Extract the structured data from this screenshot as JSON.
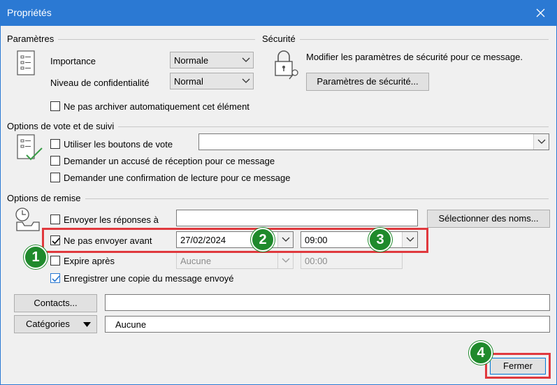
{
  "window": {
    "title": "Propriétés"
  },
  "parametres": {
    "section_label": "Paramètres",
    "importance_label": "Importance",
    "importance_value": "Normale",
    "confidentialite_label": "Niveau de confidentialité",
    "confidentialite_value": "Normal",
    "no_archive_label": "Ne pas archiver automatiquement cet élément"
  },
  "securite": {
    "section_label": "Sécurité",
    "description": "Modifier les paramètres de sécurité pour ce message.",
    "button_label": "Paramètres de sécurité..."
  },
  "vote": {
    "section_label": "Options de vote et de suivi",
    "use_vote_buttons_label": "Utiliser les boutons de vote",
    "vote_value": "",
    "delivery_receipt_label": "Demander un accusé de réception pour ce message",
    "read_receipt_label": "Demander une confirmation de lecture pour ce message"
  },
  "remise": {
    "section_label": "Options de remise",
    "reply_to_label": "Envoyer les réponses à",
    "reply_to_value": "",
    "select_names_button": "Sélectionner des noms...",
    "do_not_send_before_label": "Ne pas envoyer avant",
    "do_not_send_before_checked": true,
    "send_date": "27/02/2024",
    "send_time": "09:00",
    "expire_label": "Expire après",
    "expire_checked": false,
    "expire_date": "Aucune",
    "expire_time": "00:00",
    "save_copy_label": "Enregistrer une copie du message envoyé",
    "save_copy_checked": true
  },
  "contacts": {
    "button_label": "Contacts...",
    "value": ""
  },
  "categories": {
    "button_label": "Catégories",
    "value": "Aucune"
  },
  "footer": {
    "close_button": "Fermer"
  },
  "annotations": {
    "badge1": "1",
    "badge2": "2",
    "badge3": "3",
    "badge4": "4"
  },
  "colors": {
    "titlebar": "#2b79d3",
    "highlight": "#e0393e",
    "badge": "#1f8a2c"
  }
}
